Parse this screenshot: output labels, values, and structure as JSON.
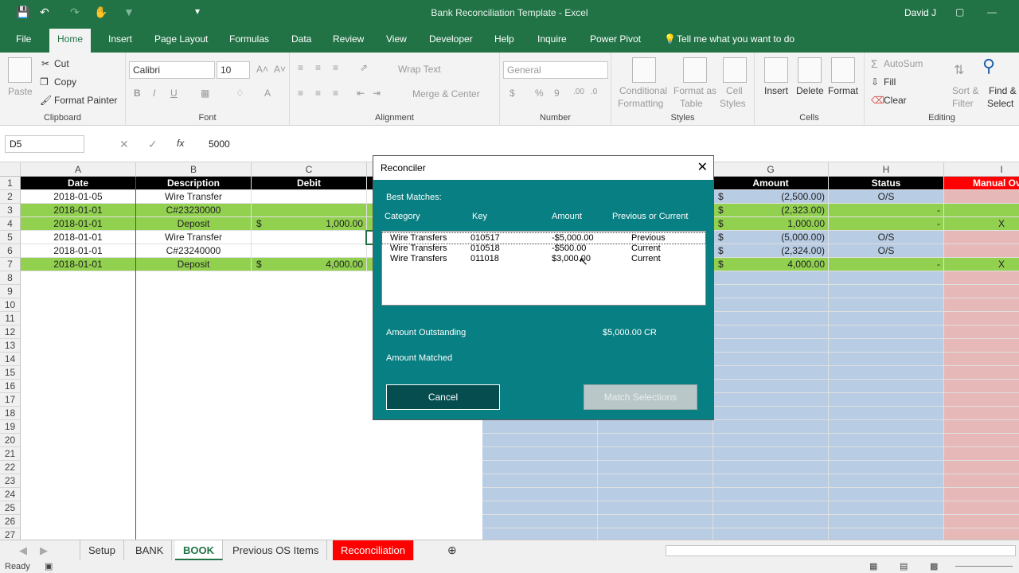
{
  "window": {
    "title": "Bank Reconciliation Template - Excel",
    "user": "David J"
  },
  "menu_tabs": [
    "File",
    "Home",
    "Insert",
    "Page Layout",
    "Formulas",
    "Data",
    "Review",
    "View",
    "Developer",
    "Help",
    "Inquire",
    "Power Pivot"
  ],
  "tell_me": "Tell me what you want to do",
  "ribbon": {
    "clipboard": {
      "paste": "Paste",
      "cut": "Cut",
      "copy": "Copy",
      "format_painter": "Format Painter",
      "label": "Clipboard"
    },
    "font": {
      "name": "Calibri",
      "size": "10",
      "label": "Font"
    },
    "alignment": {
      "wrap": "Wrap Text",
      "merge": "Merge & Center",
      "label": "Alignment"
    },
    "number": {
      "format": "General",
      "label": "Number"
    },
    "styles": {
      "conditional": "Conditional",
      "formatting": "Formatting",
      "format_as": "Format as",
      "table": "Table",
      "cell": "Cell",
      "styles_word": "Styles",
      "label": "Styles"
    },
    "cells": {
      "insert": "Insert",
      "delete": "Delete",
      "format": "Format",
      "label": "Cells"
    },
    "editing": {
      "autosum": "AutoSum",
      "fill": "Fill",
      "clear": "Clear",
      "sort": "Sort &",
      "filter": "Filter",
      "find": "Find &",
      "select": "Select",
      "label": "Editing"
    }
  },
  "formula_bar": {
    "name_box": "D5",
    "value": "5000"
  },
  "columns": [
    "A",
    "B",
    "C",
    "G",
    "H",
    "I"
  ],
  "header_row": {
    "date": "Date",
    "description": "Description",
    "debit": "Debit",
    "amount": "Amount",
    "status": "Status",
    "override": "Manual Over"
  },
  "rows": [
    {
      "date": "2018-01-05",
      "desc": "Wire Transfer",
      "debit": "",
      "amount": "(2,500.00)",
      "status": "O/S",
      "mark": "",
      "green": false
    },
    {
      "date": "2018-01-01",
      "desc": "C#23230000",
      "debit": "",
      "amount": "(2,323.00)",
      "status": "-",
      "mark": "",
      "green": true
    },
    {
      "date": "2018-01-01",
      "desc": "Deposit",
      "debit": "1,000.00",
      "amount": "1,000.00",
      "status": "-",
      "mark": "X",
      "green": true
    },
    {
      "date": "2018-01-01",
      "desc": "Wire Transfer",
      "debit": "",
      "amount": "(5,000.00)",
      "status": "O/S",
      "mark": "",
      "green": false
    },
    {
      "date": "2018-01-01",
      "desc": "C#23240000",
      "debit": "",
      "amount": "(2,324.00)",
      "status": "O/S",
      "mark": "",
      "green": false
    },
    {
      "date": "2018-01-01",
      "desc": "Deposit",
      "debit": "4,000.00",
      "amount": "4,000.00",
      "status": "-",
      "mark": "X",
      "green": true
    }
  ],
  "row_numbers": [
    "1",
    "2",
    "3",
    "4",
    "5",
    "6",
    "7",
    "8",
    "9",
    "10",
    "11",
    "12",
    "13",
    "14",
    "15",
    "16",
    "17",
    "18",
    "19",
    "20",
    "21",
    "22",
    "23",
    "24",
    "25",
    "26",
    "27"
  ],
  "currency": "$",
  "dialog": {
    "title": "Reconciler",
    "best_matches": "Best Matches:",
    "col_category": "Category",
    "col_key": "Key",
    "col_amount": "Amount",
    "col_prev": "Previous or Current",
    "matches": [
      {
        "category": "Wire Transfers",
        "key": "010517",
        "amount": "-$5,000.00",
        "prev": "Previous"
      },
      {
        "category": "Wire Transfers",
        "key": "010518",
        "amount": "-$500.00",
        "prev": "Current"
      },
      {
        "category": "Wire Transfers",
        "key": "011018",
        "amount": "$3,000.00",
        "prev": "Current"
      }
    ],
    "amount_outstanding_label": "Amount Outstanding",
    "amount_outstanding_value": "$5,000.00 CR",
    "amount_matched_label": "Amount Matched",
    "cancel": "Cancel",
    "match": "Match Selections"
  },
  "sheet_tabs": [
    "Setup",
    "BANK",
    "BOOK",
    "Previous OS Items",
    "Reconciliation"
  ],
  "status": "Ready"
}
